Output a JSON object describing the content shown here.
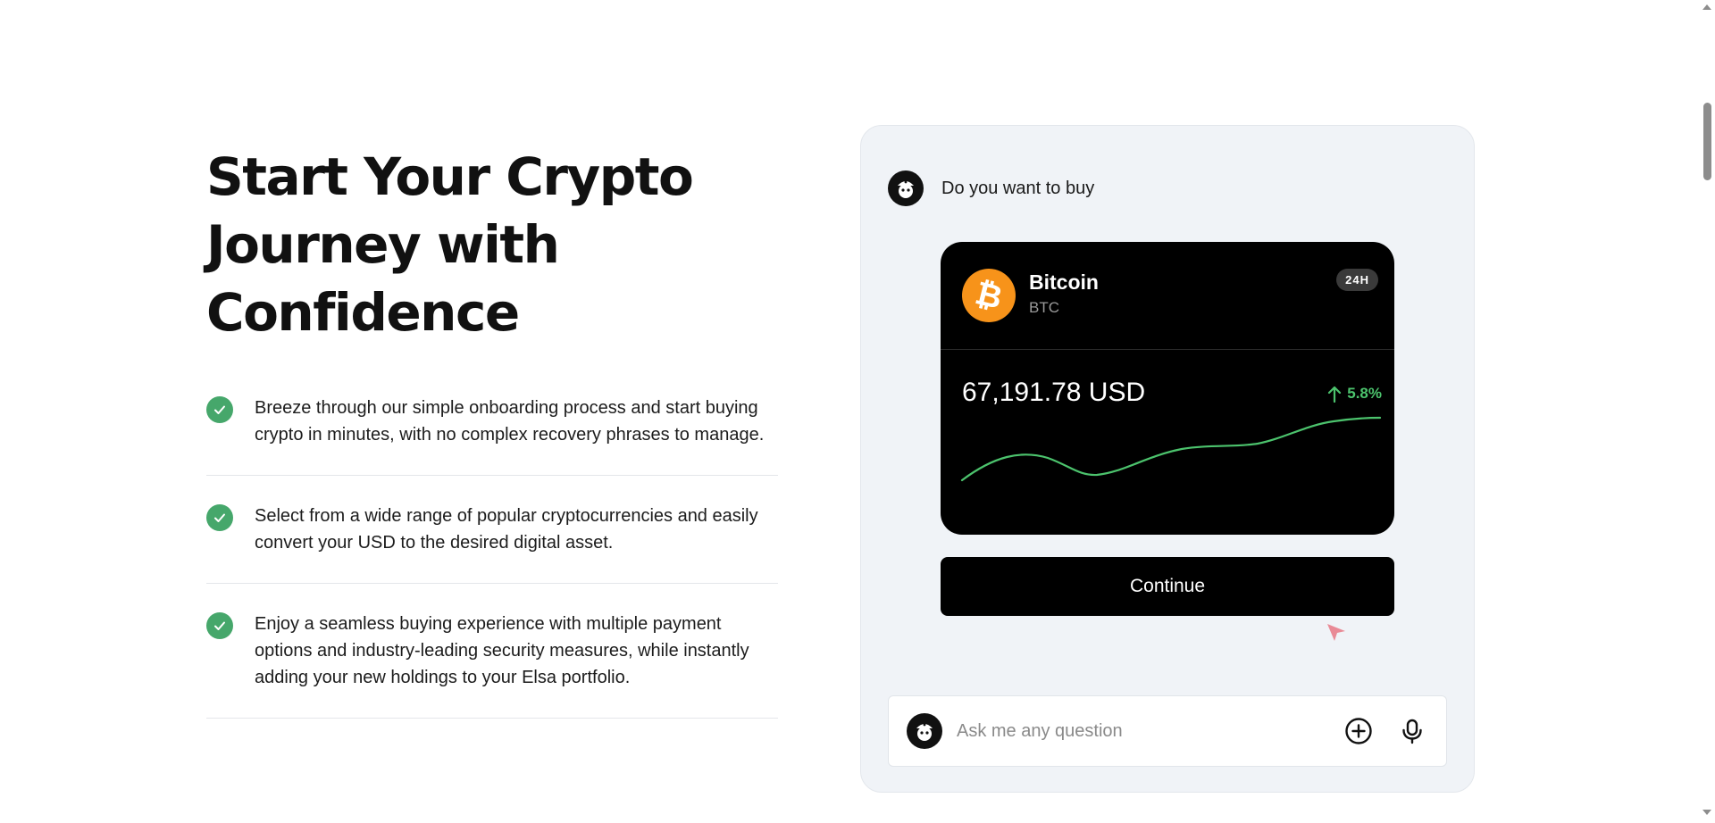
{
  "hero": {
    "headline": "Start Your Crypto Journey with Confidence",
    "features": [
      {
        "text": "Breeze through our simple onboarding process and start buying crypto in minutes, with no complex recovery phrases to manage."
      },
      {
        "text": "Select from a wide range of popular cryptocurrencies and easily convert your USD to the desired digital asset."
      },
      {
        "text": "Enjoy a seamless buying experience with multiple payment options and industry-leading security measures, while instantly adding your new holdings to your Elsa portfolio."
      }
    ]
  },
  "chat": {
    "bot_message": "Do you want to buy",
    "card": {
      "name": "Bitcoin",
      "symbol": "BTC",
      "range": "24H",
      "price": "67,191.78 USD",
      "change": "5.8%",
      "trend": "up"
    },
    "continue_label": "Continue",
    "ask_placeholder": "Ask me any question"
  },
  "colors": {
    "accent_green": "#46a76b",
    "trend_green": "#4cc36d",
    "bitcoin_orange": "#f7931a",
    "panel_bg": "#f0f3f7"
  },
  "icons": [
    "check-icon",
    "bot-avatar-icon",
    "bitcoin-icon",
    "arrow-up-icon",
    "plus-circle-icon",
    "microphone-icon",
    "cursor-pointer-icon"
  ]
}
